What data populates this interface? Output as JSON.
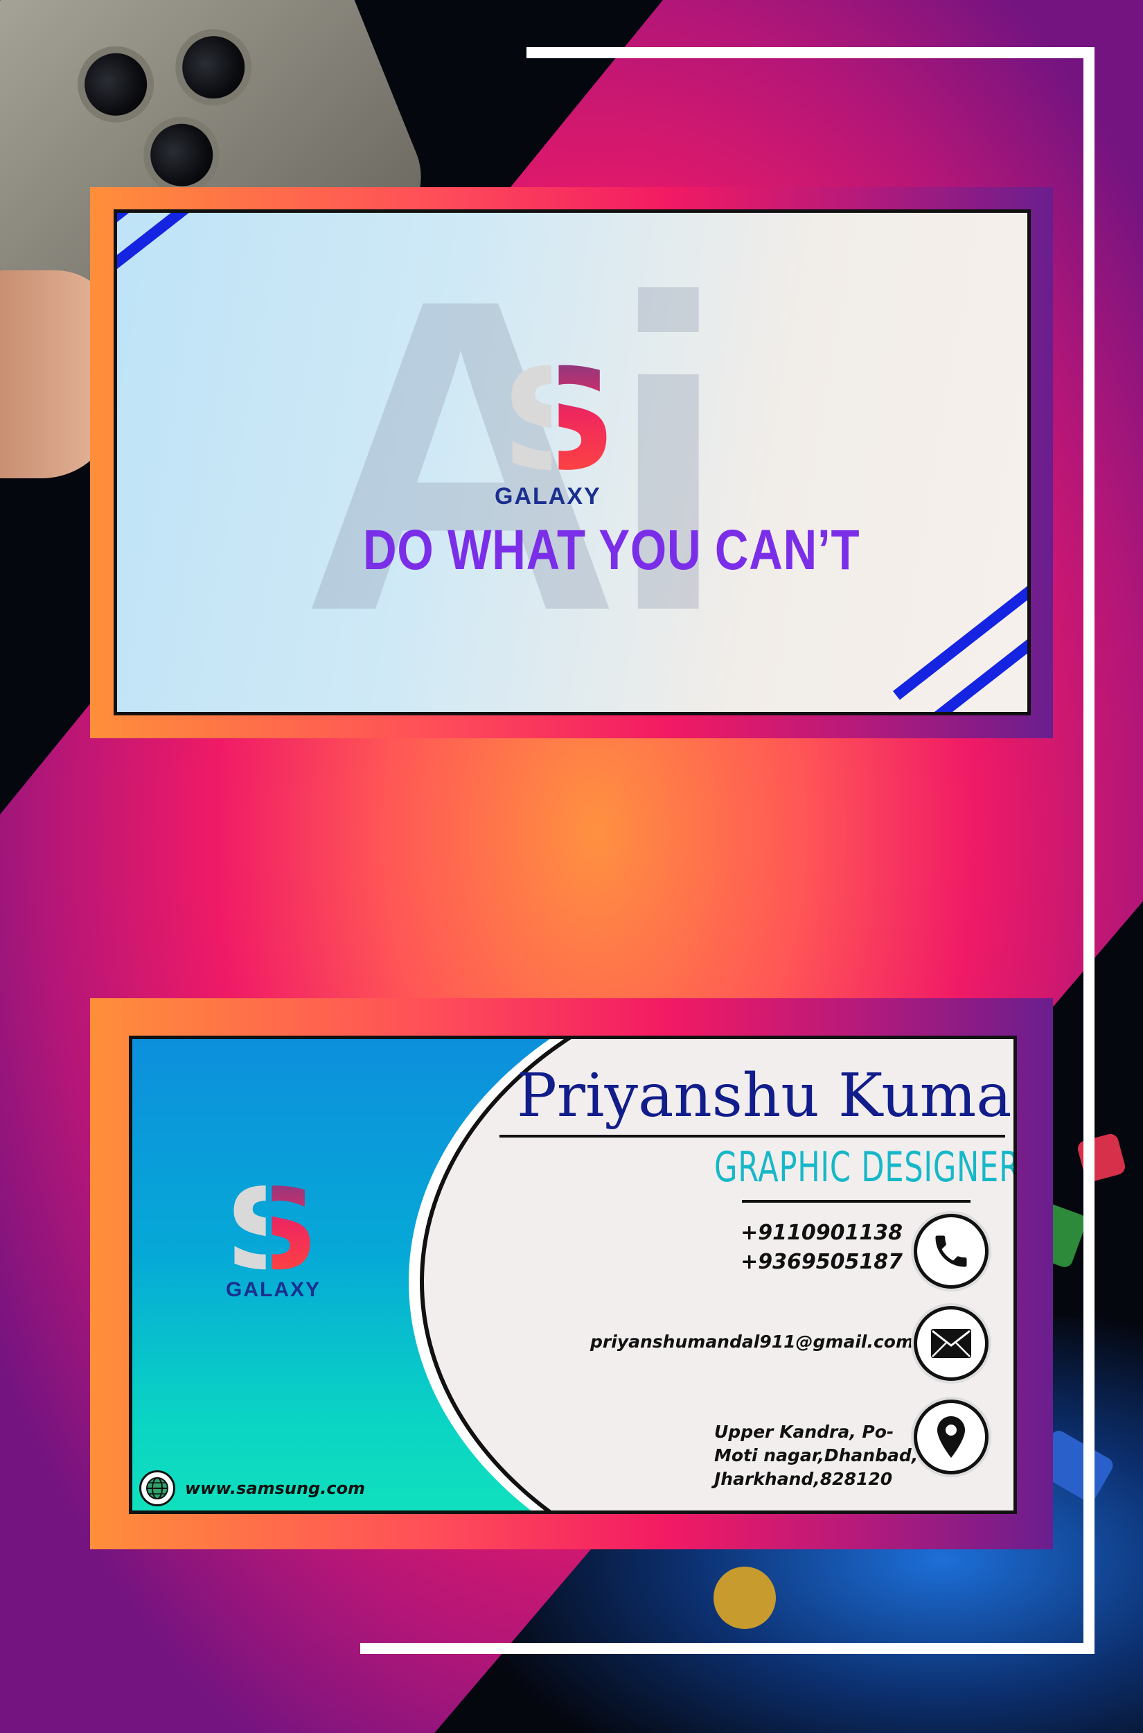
{
  "front_card": {
    "watermark": "Ai",
    "logo_letter": "S",
    "brand": "GALAXY",
    "tagline": "DO WHAT YOU CAN’T"
  },
  "back_card": {
    "logo_letter": "S",
    "brand": "GALAXY",
    "name": "Priyanshu Kumar",
    "role": "GRAPHIC DESIGNER",
    "phones": [
      "+9110901138",
      "+9369505187"
    ],
    "email": "priyanshumandal911@gmail.com",
    "address": "Upper Kandra, Po-Moti nagar,Dhanbad, Jharkhand,828120",
    "website": "www.samsung.com"
  },
  "icons": {
    "phone": "phone-icon",
    "email": "mail-icon",
    "address": "location-pin-icon",
    "website": "globe-icon"
  },
  "colors": {
    "brand_blue": "#1b2f8f",
    "tagline_purple": "#7b2ee8",
    "name_navy": "#111d8a",
    "role_cyan": "#16b8c8",
    "accent_pink": "#f21a63",
    "accent_orange": "#ff8f3a"
  }
}
